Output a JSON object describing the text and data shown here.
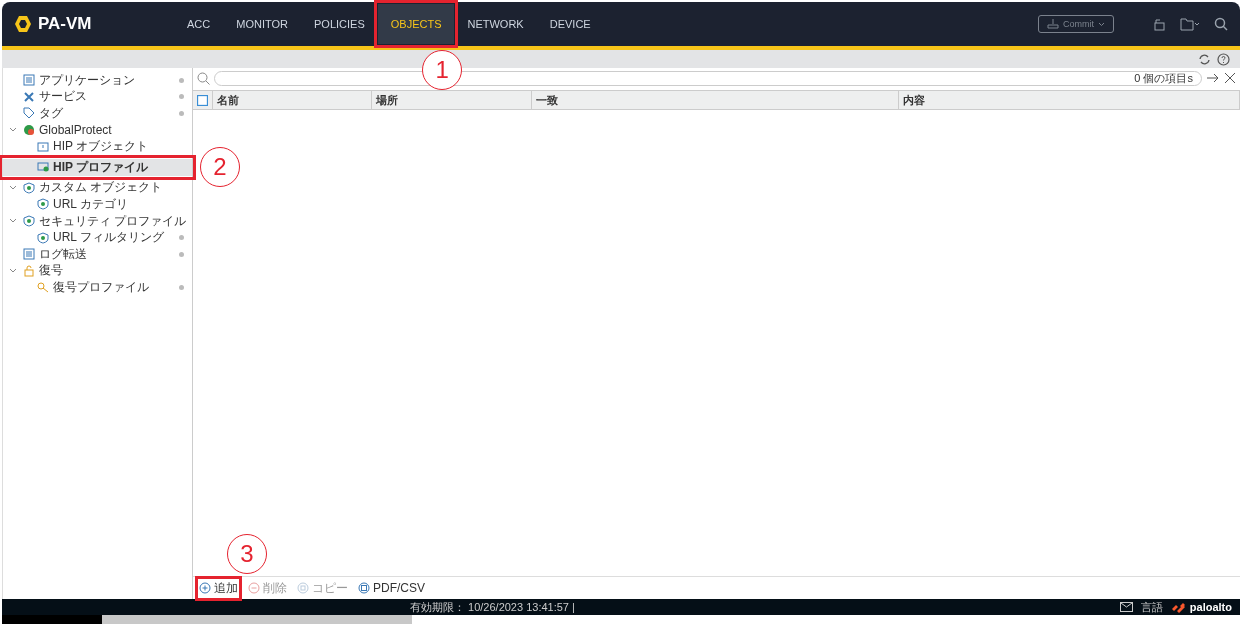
{
  "header": {
    "product": "PA-VM",
    "tabs": [
      {
        "label": "ACC",
        "selected": false
      },
      {
        "label": "MONITOR",
        "selected": false
      },
      {
        "label": "POLICIES",
        "selected": false
      },
      {
        "label": "OBJECTS",
        "selected": true,
        "annotation": "1"
      },
      {
        "label": "NETWORK",
        "selected": false
      },
      {
        "label": "DEVICE",
        "selected": false
      }
    ],
    "commit": "Commit"
  },
  "sidebar": {
    "items": [
      {
        "label": "アプリケーション",
        "dot": true,
        "selected": false
      },
      {
        "label": "サービス",
        "dot": true,
        "selected": false
      },
      {
        "label": "タグ",
        "dot": true,
        "selected": false
      },
      {
        "label": "GlobalProtect",
        "expanded": true,
        "selected": false,
        "children": [
          {
            "label": "HIP オブジェクト",
            "selected": false
          },
          {
            "label": "HIP プロファイル",
            "selected": true,
            "annotation": "2"
          }
        ]
      },
      {
        "label": "カスタム オブジェクト",
        "expanded": true,
        "selected": false,
        "children": [
          {
            "label": "URL カテゴリ",
            "selected": false
          }
        ]
      },
      {
        "label": "セキュリティ プロファイル",
        "expanded": true,
        "selected": false,
        "children": [
          {
            "label": "URL フィルタリング",
            "dot": true,
            "selected": false
          }
        ]
      },
      {
        "label": "ログ転送",
        "dot": true,
        "selected": false
      },
      {
        "label": "復号",
        "expanded": true,
        "selected": false,
        "children": [
          {
            "label": "復号プロファイル",
            "dot": true,
            "selected": false
          }
        ]
      }
    ]
  },
  "search": {
    "count": "0 個の項目s"
  },
  "table": {
    "select_all": {
      "checked": false
    },
    "columns": [
      "名前",
      "場所",
      "一致",
      "内容"
    ]
  },
  "toolbar": [
    {
      "label": "追加",
      "disabled": false,
      "annotation": "3"
    },
    {
      "label": "削除",
      "disabled": true
    },
    {
      "label": "コピー",
      "disabled": true
    },
    {
      "label": "PDF/CSV",
      "disabled": false
    }
  ],
  "status_bar": {
    "expiry": "有効期限： 10/26/2023 13:41:57 |",
    "language": "言語",
    "brand": "paloalto"
  }
}
